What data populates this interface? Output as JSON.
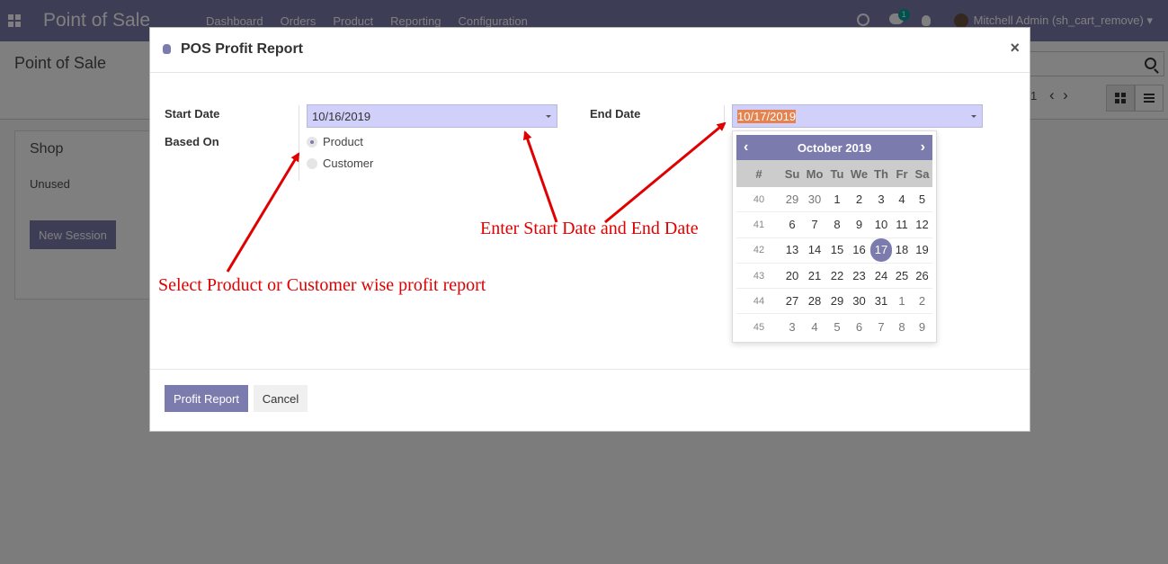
{
  "app": {
    "brand": "Point of Sale",
    "menu": [
      "Dashboard",
      "Orders",
      "Product",
      "Reporting",
      "Configuration"
    ],
    "chat_count": "1",
    "user": "Mitchell Admin (sh_cart_remove)"
  },
  "control_panel": {
    "title": "Point of Sale",
    "pager": "1"
  },
  "kanban": {
    "shop_title": "Shop",
    "status": "Unused",
    "new_session_label": "New Session"
  },
  "modal": {
    "title": "POS Profit Report",
    "start_date_label": "Start Date",
    "start_date_value": "10/16/2019",
    "based_on_label": "Based On",
    "based_on_options": [
      "Product",
      "Customer"
    ],
    "based_on_selected": "Product",
    "end_date_label": "End Date",
    "end_date_value": "10/17/2019",
    "close_glyph": "×",
    "profit_report_label": "Profit Report",
    "cancel_label": "Cancel"
  },
  "datepicker": {
    "month_label": "October 2019",
    "prev_glyph": "‹",
    "next_glyph": "›",
    "week_header": "#",
    "weekdays": [
      "Su",
      "Mo",
      "Tu",
      "We",
      "Th",
      "Fr",
      "Sa"
    ],
    "selected_day": "17",
    "weeks": [
      {
        "wk": "40",
        "days": [
          "29",
          "30",
          "1",
          "2",
          "3",
          "4",
          "5"
        ]
      },
      {
        "wk": "41",
        "days": [
          "6",
          "7",
          "8",
          "9",
          "10",
          "11",
          "12"
        ]
      },
      {
        "wk": "42",
        "days": [
          "13",
          "14",
          "15",
          "16",
          "17",
          "18",
          "19"
        ]
      },
      {
        "wk": "43",
        "days": [
          "20",
          "21",
          "22",
          "23",
          "24",
          "25",
          "26"
        ]
      },
      {
        "wk": "44",
        "days": [
          "27",
          "28",
          "29",
          "30",
          "31",
          "1",
          "2"
        ]
      },
      {
        "wk": "45",
        "days": [
          "3",
          "4",
          "5",
          "6",
          "7",
          "8",
          "9"
        ]
      }
    ]
  },
  "annotations": {
    "dates": "Enter Start Date and End Date",
    "based_on": "Select Product or Customer wise profit report"
  },
  "colors": {
    "brand": "#7c7bad",
    "date_input_bg": "#d0d0fb",
    "annotation": "#e00000",
    "selection": "#e6824e"
  }
}
